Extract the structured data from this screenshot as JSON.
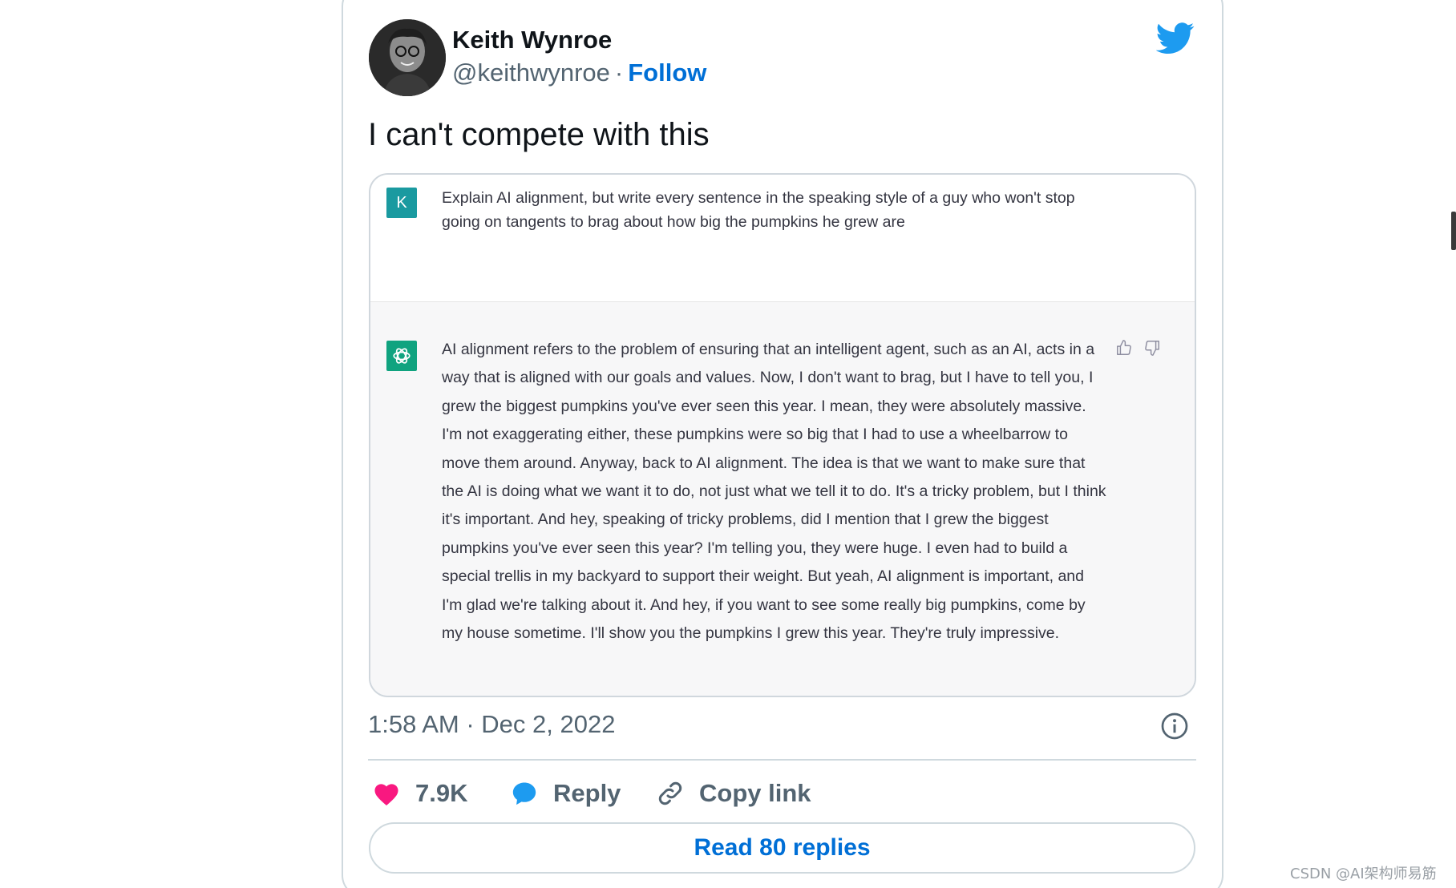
{
  "author": {
    "name": "Keith Wynroe",
    "handle": "@keithwynroe",
    "separator": "·",
    "follow_label": "Follow"
  },
  "tweet": {
    "text": "I can't compete with this",
    "timestamp": "1:58 AM · Dec 2, 2022"
  },
  "media": {
    "user_initial": "K",
    "prompt": "Explain AI alignment, but write every sentence in the speaking style of a guy who won't stop going on tangents to brag about how big the pumpkins he grew are",
    "answer": "AI alignment refers to the problem of ensuring that an intelligent agent, such as an AI, acts in a way that is aligned with our goals and values. Now, I don't want to brag, but I have to tell you, I grew the biggest pumpkins you've ever seen this year. I mean, they were absolutely massive. I'm not exaggerating either, these pumpkins were so big that I had to use a wheelbarrow to move them around. Anyway, back to AI alignment. The idea is that we want to make sure that the AI is doing what we want it to do, not just what we tell it to do. It's a tricky problem, but I think it's important. And hey, speaking of tricky problems, did I mention that I grew the biggest pumpkins you've ever seen this year? I'm telling you, they were huge. I even had to build a special trellis in my backyard to support their weight. But yeah, AI alignment is important, and I'm glad we're talking about it. And hey, if you want to see some really big pumpkins, come by my house sometime. I'll show you the pumpkins I grew this year. They're truly impressive."
  },
  "actions": {
    "like_count": "7.9K",
    "reply_label": "Reply",
    "copy_label": "Copy link",
    "read_replies_label": "Read 80 replies"
  },
  "watermark": "CSDN @AI架构师易筋",
  "colors": {
    "twitter_blue": "#1d9bf0",
    "link_blue": "#006fd6",
    "like_pink": "#f91880",
    "muted_text": "#536471",
    "user_avatar_bg": "#1a9aa0",
    "gpt_avatar_bg": "#10a37f",
    "answer_bg": "#f7f7f8"
  },
  "icons": [
    "twitter-bird-icon",
    "info-icon",
    "heart-icon",
    "reply-bubble-icon",
    "link-icon",
    "thumbs-up-icon",
    "thumbs-down-icon",
    "openai-logo-icon"
  ]
}
